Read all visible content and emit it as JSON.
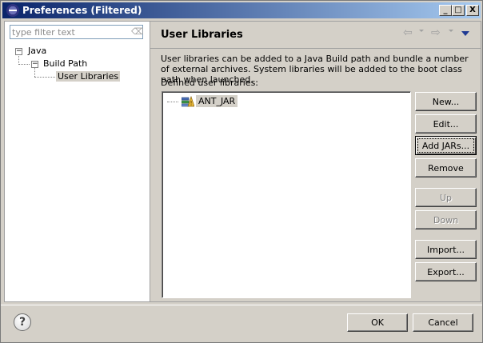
{
  "window": {
    "title": "Preferences (Filtered)",
    "minimize_glyph": "_",
    "maximize_glyph": "□",
    "close_glyph": "X"
  },
  "filter": {
    "placeholder": "type filter text",
    "clear_glyph": "⌫"
  },
  "tree": {
    "items": [
      {
        "label": "Java",
        "expander": "−"
      },
      {
        "label": "Build Path",
        "expander": "−"
      },
      {
        "label": "User Libraries",
        "selected": true
      }
    ]
  },
  "page": {
    "title": "User Libraries",
    "back_glyph": "⇦",
    "forward_glyph": "⇨",
    "description": "User libraries can be added to a Java Build path and bundle a number of external archives. System libraries will be added to the boot class path when launched.",
    "list_label": "Defined user libraries:",
    "libraries": [
      {
        "name": "ANT_JAR",
        "selected": true
      }
    ]
  },
  "buttons": {
    "new": "New...",
    "edit": "Edit...",
    "add_jars": "Add JARs...",
    "remove": "Remove",
    "up": "Up",
    "down": "Down",
    "import": "Import...",
    "export": "Export..."
  },
  "footer": {
    "help_glyph": "?",
    "ok": "OK",
    "cancel": "Cancel"
  },
  "colors": {
    "titlebar_start": "#0a246a",
    "titlebar_end": "#a6caf0",
    "dialog_face": "#d4d0c8",
    "menu_arrow": "#1f3a93"
  },
  "icons": {
    "library": "library-jar-icon",
    "help": "help-icon"
  }
}
